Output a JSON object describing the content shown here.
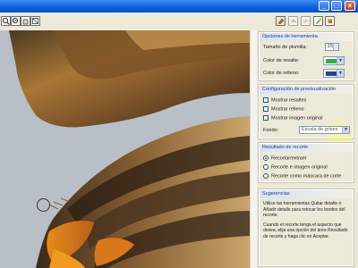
{
  "window": {
    "buttons": {
      "minimize": "_",
      "maximize": "□",
      "close": "×"
    }
  },
  "toolbar": {
    "left_tools": [
      "zoom-in-icon",
      "zoom-out-icon",
      "hand-icon",
      "fit-icon"
    ],
    "right_tools": [
      "highlighter-icon",
      "fill-icon",
      "eraser-icon",
      "marker-icon",
      "paint-icon"
    ]
  },
  "tool_options": {
    "title": "Opciones de herramienta",
    "pen_size_label": "Tamaño de plumilla:",
    "pen_size_value": "15",
    "highlight_color_label": "Color de resalte:",
    "highlight_color": "#2bb04a",
    "fill_color_label": "Color de relleno:",
    "fill_color": "#2a3f8f"
  },
  "preview_config": {
    "title": "Configuración de previsualización",
    "show_highlight": "Mostrar resaltes",
    "show_fill": "Mostrar relleno",
    "show_original": "Mostrar imagen original",
    "background_label": "Fondo:",
    "background_value": "Escala de grises"
  },
  "crop_result": {
    "title": "Resultado de recorte",
    "options": [
      "Recortar/extraer",
      "Recorte e imagen original",
      "Recorte como máscara de corte"
    ],
    "selected_index": 0
  },
  "tips": {
    "title": "Sugerencias",
    "paragraph1": "Utilice las herramientas Quitar detalle o Añadir detalle para retocar los bordes del recorte.",
    "paragraph2": "Cuando el recorte tenga el aspecto que desea, elija una opción del área Resultado de recorte y haga clic en Aceptar."
  },
  "colors": {
    "accent": "#1a3a8a",
    "window_blue": "#0a5fd8",
    "panel_bg": "#ece9d8"
  }
}
